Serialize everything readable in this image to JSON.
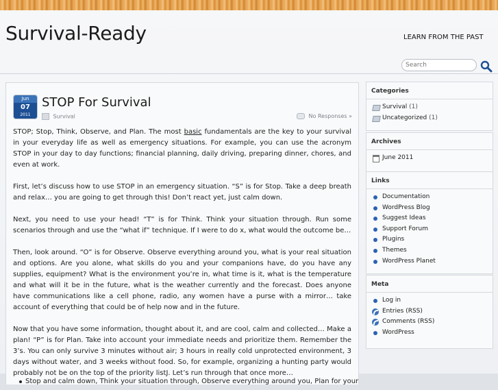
{
  "header": {
    "site_title": "Survival-Ready",
    "tagline": "LEARN FROM THE PAST",
    "search_placeholder": "Search"
  },
  "post": {
    "date": {
      "month": "Jun",
      "day": "07",
      "year": "2011"
    },
    "title": "STOP For Survival",
    "category": "Survival",
    "comments": "No Responses »",
    "paragraphs": [
      {
        "pre": "STOP;  Stop, Think, Observe, and Plan.  The most ",
        "link": "basic",
        "post": " fundamentals are the key to your survival in your everyday life as well as emergency situations.  For example, you can use the acronym STOP in your day to day functions; financial planning, daily driving, preparing dinner, chores, and even at work."
      },
      {
        "pre": "First, let’s discuss how to use STOP in an emergency situation.  “S” is for Stop.  Take a deep breath and relax… you are going to get through this!  Don’t react yet, just calm down.",
        "link": "",
        "post": ""
      },
      {
        "pre": "Next, you need to use your head!  “T” is for Think.  Think your situation through.  Run some scenarios through and use the “what if” technique.  If I were to do x, what would the outcome be…",
        "link": "",
        "post": ""
      },
      {
        "pre": "Then, look around.  “O” is for Observe.  Observe everything around you, what is your real situation and options.  Are you alone, what skills do you and your companions have, do you have any supplies, equipment?   What is the environment you’re in, what time is it, what is the temperature and what will it be in the future, what is the weather currently and the forecast.  Does anyone have communications like a cell phone, radio, any women have a purse with a mirror… take account of everything that could be of help now and in the future.",
        "link": "",
        "post": ""
      },
      {
        "pre": "Now that you have some information, thought about it, and are cool, calm and collected… Make a plan!  “P” is for Plan.  Take into account your immediate needs and prioritize them.  Remember the 3’s.  You can only survive 3 minutes without air; 3 hours in really cold unprotected environment, 3 days without water, and 3 weeks without food.  So, for example, organizing a hunting party would probably not be on the top of the priority listJ.  Let’s run through that once more…",
        "link": "",
        "post": ""
      }
    ],
    "bullet_partial": "Stop and calm down, Think your situation through, Observe everything around you, Plan for your"
  },
  "sidebar": {
    "categories": {
      "title": "Categories",
      "items": [
        {
          "label": "Survival",
          "count": "(1)"
        },
        {
          "label": "Uncategorized",
          "count": "(1)"
        }
      ]
    },
    "archives": {
      "title": "Archives",
      "items": [
        {
          "label": "June 2011"
        }
      ]
    },
    "links": {
      "title": "Links",
      "items": [
        {
          "label": "Documentation"
        },
        {
          "label": "WordPress Blog"
        },
        {
          "label": "Suggest Ideas"
        },
        {
          "label": "Support Forum"
        },
        {
          "label": "Plugins"
        },
        {
          "label": "Themes"
        },
        {
          "label": "WordPress Planet"
        }
      ]
    },
    "meta": {
      "title": "Meta",
      "items": [
        {
          "label": "Log in",
          "icon": "dot"
        },
        {
          "label": "Entries (RSS)",
          "icon": "rss"
        },
        {
          "label": "Comments (RSS)",
          "icon": "rss"
        },
        {
          "label": "WordPress",
          "icon": "dot"
        }
      ]
    }
  },
  "colors": {
    "accent": "#2c62b2",
    "wood": "#e7a24f"
  }
}
